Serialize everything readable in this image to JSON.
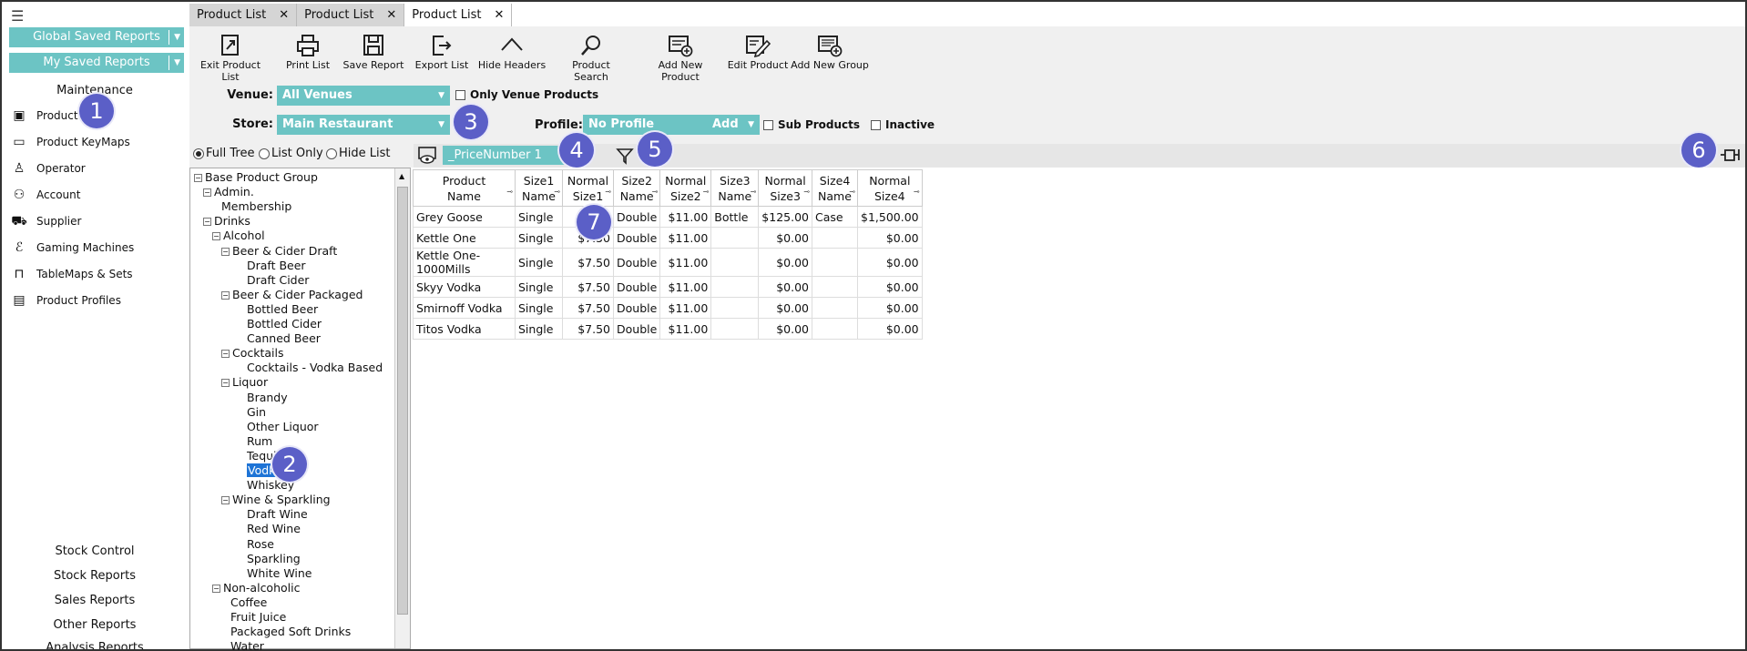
{
  "sidebar": {
    "global_saved_reports": "Global Saved Reports",
    "my_saved_reports": "My Saved Reports",
    "section_title": "Maintenance",
    "items": [
      {
        "label": "Product",
        "icon": "product-icon"
      },
      {
        "label": "Product KeyMaps",
        "icon": "keymap-icon"
      },
      {
        "label": "Operator",
        "icon": "person-icon"
      },
      {
        "label": "Account",
        "icon": "account-icon"
      },
      {
        "label": "Supplier",
        "icon": "truck-icon"
      },
      {
        "label": "Gaming Machines",
        "icon": "gaming-icon"
      },
      {
        "label": "TableMaps & Sets",
        "icon": "table-icon"
      },
      {
        "label": "Product Profiles",
        "icon": "profile-icon"
      }
    ],
    "bottom_links": [
      "Stock Control",
      "Stock Reports",
      "Sales Reports",
      "Other Reports",
      "Analysis Reports"
    ]
  },
  "tabs": [
    {
      "label": "Product List",
      "active": false
    },
    {
      "label": "Product List",
      "active": false
    },
    {
      "label": "Product List",
      "active": true
    }
  ],
  "toolbar": {
    "exit": "Exit Product List",
    "print": "Print List",
    "save": "Save Report",
    "export": "Export List",
    "hide_headers": "Hide Headers",
    "search": "Product Search",
    "add_product": "Add New Product",
    "edit_product": "Edit Product",
    "add_group": "Add New Group"
  },
  "filters": {
    "venue_label": "Venue:",
    "venue_value": "All Venues",
    "only_venue_products": "Only Venue Products",
    "store_label": "Store:",
    "store_value": "Main Restaurant",
    "profile_label": "Profile:",
    "profile_value": "No Profile",
    "profile_add": "Add",
    "sub_products": "Sub Products",
    "inactive": "Inactive",
    "radio_full_tree": "Full Tree",
    "radio_list_only": "List Only",
    "radio_hide_list": "Hide List",
    "column_search": "_PriceNumber 1"
  },
  "badges": [
    "1",
    "2",
    "3",
    "4",
    "5",
    "6",
    "7"
  ],
  "tree": [
    {
      "label": "Base Product Group",
      "level": 0,
      "toggle": "minus"
    },
    {
      "label": "Admin.",
      "level": 1,
      "toggle": "minus"
    },
    {
      "label": "Membership",
      "level": 2,
      "toggle": ""
    },
    {
      "label": "Drinks",
      "level": 1,
      "toggle": "minus"
    },
    {
      "label": "Alcohol",
      "level": 2,
      "toggle": "minus"
    },
    {
      "label": "Beer & Cider Draft",
      "level": 3,
      "toggle": "minus"
    },
    {
      "label": "Draft Beer",
      "level": 4,
      "toggle": ""
    },
    {
      "label": "Draft Cider",
      "level": 4,
      "toggle": ""
    },
    {
      "label": "Beer & Cider Packaged",
      "level": 3,
      "toggle": "minus"
    },
    {
      "label": "Bottled Beer",
      "level": 4,
      "toggle": ""
    },
    {
      "label": "Bottled Cider",
      "level": 4,
      "toggle": ""
    },
    {
      "label": "Canned Beer",
      "level": 4,
      "toggle": ""
    },
    {
      "label": "Cocktails",
      "level": 3,
      "toggle": "minus"
    },
    {
      "label": "Cocktails - Vodka Based",
      "level": 4,
      "toggle": ""
    },
    {
      "label": "Liquor",
      "level": 3,
      "toggle": "minus"
    },
    {
      "label": "Brandy",
      "level": 4,
      "toggle": ""
    },
    {
      "label": "Gin",
      "level": 4,
      "toggle": ""
    },
    {
      "label": "Other Liquor",
      "level": 4,
      "toggle": ""
    },
    {
      "label": "Rum",
      "level": 4,
      "toggle": ""
    },
    {
      "label": "Tequila",
      "level": 4,
      "toggle": ""
    },
    {
      "label": "Vodka",
      "level": 4,
      "toggle": "",
      "selected": true
    },
    {
      "label": "Whiskey",
      "level": 4,
      "toggle": ""
    },
    {
      "label": "Wine & Sparkling",
      "level": 3,
      "toggle": "minus"
    },
    {
      "label": "Draft Wine",
      "level": 4,
      "toggle": ""
    },
    {
      "label": "Red Wine",
      "level": 4,
      "toggle": ""
    },
    {
      "label": "Rose",
      "level": 4,
      "toggle": ""
    },
    {
      "label": "Sparkling",
      "level": 4,
      "toggle": ""
    },
    {
      "label": "White Wine",
      "level": 4,
      "toggle": ""
    },
    {
      "label": "Non-alcoholic",
      "level": 2,
      "toggle": "minus"
    },
    {
      "label": "Coffee",
      "level": 3,
      "toggle": ""
    },
    {
      "label": "Fruit Juice",
      "level": 3,
      "toggle": ""
    },
    {
      "label": "Packaged Soft Drinks",
      "level": 3,
      "toggle": ""
    },
    {
      "label": "Water",
      "level": 3,
      "toggle": ""
    }
  ],
  "grid": {
    "headers": [
      [
        "Product",
        "Name"
      ],
      [
        "Size1",
        "Name"
      ],
      [
        "Normal",
        "Size1"
      ],
      [
        "Size2",
        "Name"
      ],
      [
        "Normal",
        "Size2"
      ],
      [
        "Size3",
        "Name"
      ],
      [
        "Normal",
        "Size3"
      ],
      [
        "Size4",
        "Name"
      ],
      [
        "Normal",
        "Size4"
      ]
    ],
    "rows": [
      [
        "Grey Goose",
        "Single",
        "$7.50",
        "Double",
        "$11.00",
        "Bottle",
        "$125.00",
        "Case",
        "$1,500.00"
      ],
      [
        "Kettle One",
        "Single",
        "$7.50",
        "Double",
        "$11.00",
        "",
        "$0.00",
        "",
        "$0.00"
      ],
      [
        "Kettle One-1000Mills",
        "Single",
        "$7.50",
        "Double",
        "$11.00",
        "",
        "$0.00",
        "",
        "$0.00"
      ],
      [
        "Skyy Vodka",
        "Single",
        "$7.50",
        "Double",
        "$11.00",
        "",
        "$0.00",
        "",
        "$0.00"
      ],
      [
        "Smirnoff Vodka",
        "Single",
        "$7.50",
        "Double",
        "$11.00",
        "",
        "$0.00",
        "",
        "$0.00"
      ],
      [
        "Titos Vodka",
        "Single",
        "$7.50",
        "Double",
        "$11.00",
        "",
        "$0.00",
        "",
        "$0.00"
      ]
    ]
  }
}
